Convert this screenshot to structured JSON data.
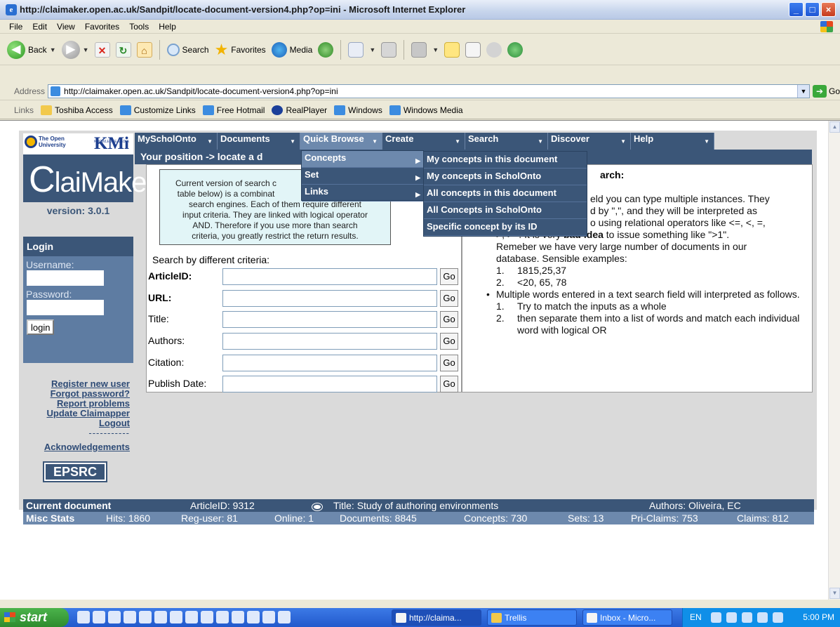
{
  "window": {
    "title": "http://claimaker.open.ac.uk/Sandpit/locate-document-version4.php?op=ini - Microsoft Internet Explorer"
  },
  "menubar": [
    "File",
    "Edit",
    "View",
    "Favorites",
    "Tools",
    "Help"
  ],
  "toolbar": {
    "back": "Back",
    "search": "Search",
    "favorites": "Favorites",
    "media": "Media"
  },
  "address": {
    "label": "Address",
    "value": "http://claimaker.open.ac.uk/Sandpit/locate-document-version4.php?op=ini",
    "go": "Go"
  },
  "links": {
    "label": "Links",
    "items": [
      "Toshiba Access",
      "Customize Links",
      "Free Hotmail",
      "RealPlayer",
      "Windows",
      "Windows Media"
    ]
  },
  "site": {
    "ou_logo": "The Open University",
    "kmi_logo": "KMi",
    "kmi_sup": "KNOWLEDGE MEDIA INSTITUTE",
    "claimaker_logo_c": "C",
    "claimaker_logo_rest": "laiMaker",
    "version": "version: 3.0.1",
    "epsrc": "EPSRC"
  },
  "login": {
    "header": "Login",
    "username_label": "Username:",
    "password_label": "Password:",
    "button": "login"
  },
  "user_links": [
    "Register new user",
    "Forgot password?",
    "Report problems",
    "Update Claimapper",
    "Logout"
  ],
  "divider": "-----------",
  "acknowledgements": "Acknowledgements",
  "nav": [
    "MyScholOnto",
    "Documents",
    "Quick Browse",
    "Create",
    "Search",
    "Discover",
    "Help"
  ],
  "position": "Your position -> locate a d",
  "info_box": "Current version of search c table below) is a combinat search engines. Each of them require different input criteria. They are linked with logical operator AND. Therefore if you use more than search criteria, you greatly restrict the return results.",
  "info_lines": [
    "Current version of search c",
    "table below) is a combinat",
    "search engines. Each of them require different",
    "input criteria. They are linked with logical operator",
    "AND. Therefore if you use more than search",
    "criteria, you greatly restrict the return results."
  ],
  "criteria_label": "Search by different criteria:",
  "fields": [
    {
      "label": "ArticleID:",
      "bold": true,
      "go": "Go"
    },
    {
      "label": "URL:",
      "bold": true,
      "go": "Go"
    },
    {
      "label": "Title:",
      "bold": false,
      "go": "Go"
    },
    {
      "label": "Authors:",
      "bold": false,
      "go": "Go"
    },
    {
      "label": "Citation:",
      "bold": false,
      "go": "Go"
    },
    {
      "label": "Publish Date:",
      "bold": false,
      "go": "Go"
    }
  ],
  "help": {
    "title": "arch:",
    "line1": "eld you can type multiple instances. They",
    "line2": "d by \",\", and they will be interpreted as",
    "line3": "o using relational operators like <=, <, =,",
    "line4_pre": ">, >=. It is very ",
    "line4_bold": "bad idea",
    "line4_post": " to issue something like \">1\".",
    "line5": "Remeber we have very large number of documents in our",
    "line6": "database. Sensible examples:",
    "ex1": "1815,25,37",
    "ex2": "<20, 65, 78",
    "bullet2": "Multiple words entered in a text search field will interpreted as follows.",
    "sub1": "Try to match the inputs as a whole",
    "sub2": "then separate them into a list of words and match each individual word with logical OR",
    "n1": "1.",
    "n2": "2."
  },
  "quick_browse_menu": [
    "Concepts",
    "Set",
    "Links"
  ],
  "concepts_submenu": [
    "My concepts in this document",
    "My concepts in ScholOnto",
    "All concepts in this document",
    "All Concepts in ScholOnto",
    "Specific concept by its ID"
  ],
  "current_document": {
    "header": "Current document",
    "article": "ArticleID: 9312",
    "title": "Title: Study of authoring environments",
    "authors": "Authors: Oliveira, EC"
  },
  "misc_stats": {
    "header": "Misc Stats",
    "hits": "Hits: 1860",
    "reg_user": "Reg-user: 81",
    "online": "Online: 1",
    "documents": "Documents: 8845",
    "concepts": "Concepts: 730",
    "sets": "Sets: 13",
    "pri_claims": "Pri-Claims: 753",
    "claims": "Claims: 812"
  },
  "taskbar": {
    "start": "start",
    "tasks": [
      "http://claima...",
      "Trellis",
      "Inbox - Micro..."
    ],
    "lang": "EN",
    "clock": "5:00 PM"
  }
}
